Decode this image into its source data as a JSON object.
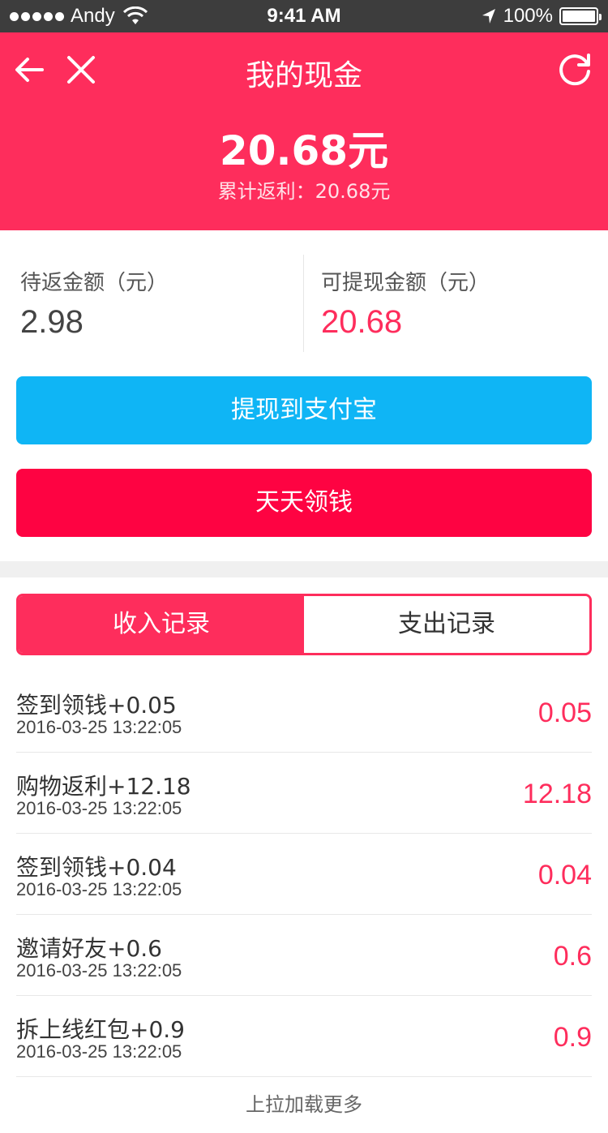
{
  "status_bar": {
    "carrier": "Andy",
    "time": "9:41 AM",
    "battery": "100%"
  },
  "header": {
    "title": "我的现金",
    "total": "20.68元",
    "cumulative": "累计返利：20.68元",
    "icons": [
      "back-arrow-icon",
      "close-icon",
      "refresh-icon"
    ]
  },
  "summary": {
    "pending_label": "待返金额（元）",
    "pending_value": "2.98",
    "withdrawable_label": "可提现金额（元）",
    "withdrawable_value": "20.68"
  },
  "buttons": {
    "withdraw_alipay": "提现到支付宝",
    "daily_reward": "天天领钱"
  },
  "tabs": {
    "income": "收入记录",
    "expense": "支出记录"
  },
  "records": [
    {
      "title": "签到领钱+0.05",
      "time": "2016-03-25 13:22:05",
      "amount": "0.05"
    },
    {
      "title": "购物返利+12.18",
      "time": "2016-03-25 13:22:05",
      "amount": "12.18"
    },
    {
      "title": "签到领钱+0.04",
      "time": "2016-03-25 13:22:05",
      "amount": "0.04"
    },
    {
      "title": "邀请好友+0.6",
      "time": "2016-03-25 13:22:05",
      "amount": "0.6"
    },
    {
      "title": "拆上线红包+0.9",
      "time": "2016-03-25 13:22:05",
      "amount": "0.9"
    }
  ],
  "load_more": "上拉加载更多",
  "colors": {
    "brand": "#fe2d5c",
    "alipay_button": "#0fb5f5",
    "daily_button": "#fe0342"
  }
}
